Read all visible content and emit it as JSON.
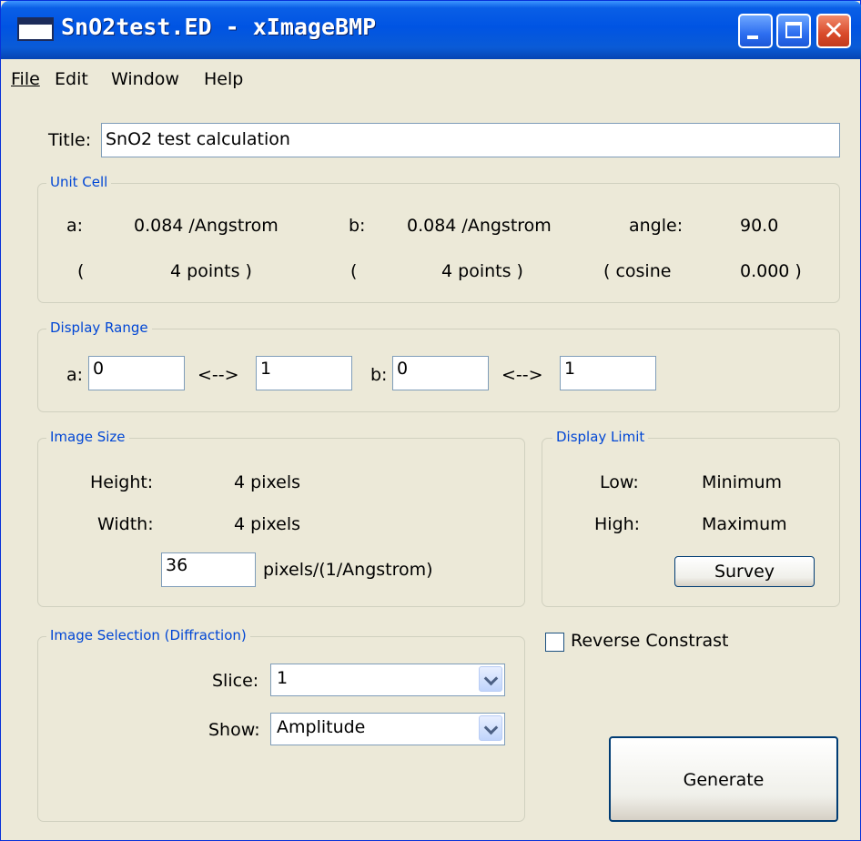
{
  "window": {
    "title": "SnO2test.ED - xImageBMP"
  },
  "menu": {
    "file": "File",
    "edit": "Edit",
    "window": "Window",
    "help": "Help"
  },
  "title_field": {
    "label": "Title:",
    "value": "SnO2 test calculation"
  },
  "unit_cell": {
    "legend": "Unit Cell",
    "a_label": "a:",
    "a_value": "0.084 /Angstrom",
    "b_label": "b:",
    "b_value": "0.084 /Angstrom",
    "angle_label": "angle:",
    "angle_value": "90.0",
    "a_open": "(",
    "a_points": "4  points )",
    "b_open": "(",
    "b_points": "4  points )",
    "cosine_label": "( cosine",
    "cosine_value": "0.000 )"
  },
  "display_range": {
    "legend": "Display Range",
    "a_label": "a:",
    "a_from": "0",
    "a_arrow": "<-->",
    "a_to": "1",
    "b_label": "b:",
    "b_from": "0",
    "b_arrow": "<-->",
    "b_to": "1"
  },
  "image_size": {
    "legend": "Image Size",
    "height_label": "Height:",
    "height_value": "4 pixels",
    "width_label": "Width:",
    "width_value": "4 pixels",
    "scale_value": "36",
    "scale_unit": "pixels/(1/Angstrom)"
  },
  "display_limit": {
    "legend": "Display Limit",
    "low_label": "Low:",
    "low_value": "Minimum",
    "high_label": "High:",
    "high_value": "Maximum",
    "survey_button": "Survey"
  },
  "image_selection": {
    "legend": "Image Selection (Diffraction)",
    "slice_label": "Slice:",
    "slice_value": "1",
    "show_label": "Show:",
    "show_value": "Amplitude"
  },
  "reverse_contrast": {
    "label": "Reverse Constrast",
    "checked": false
  },
  "generate_button": "Generate"
}
